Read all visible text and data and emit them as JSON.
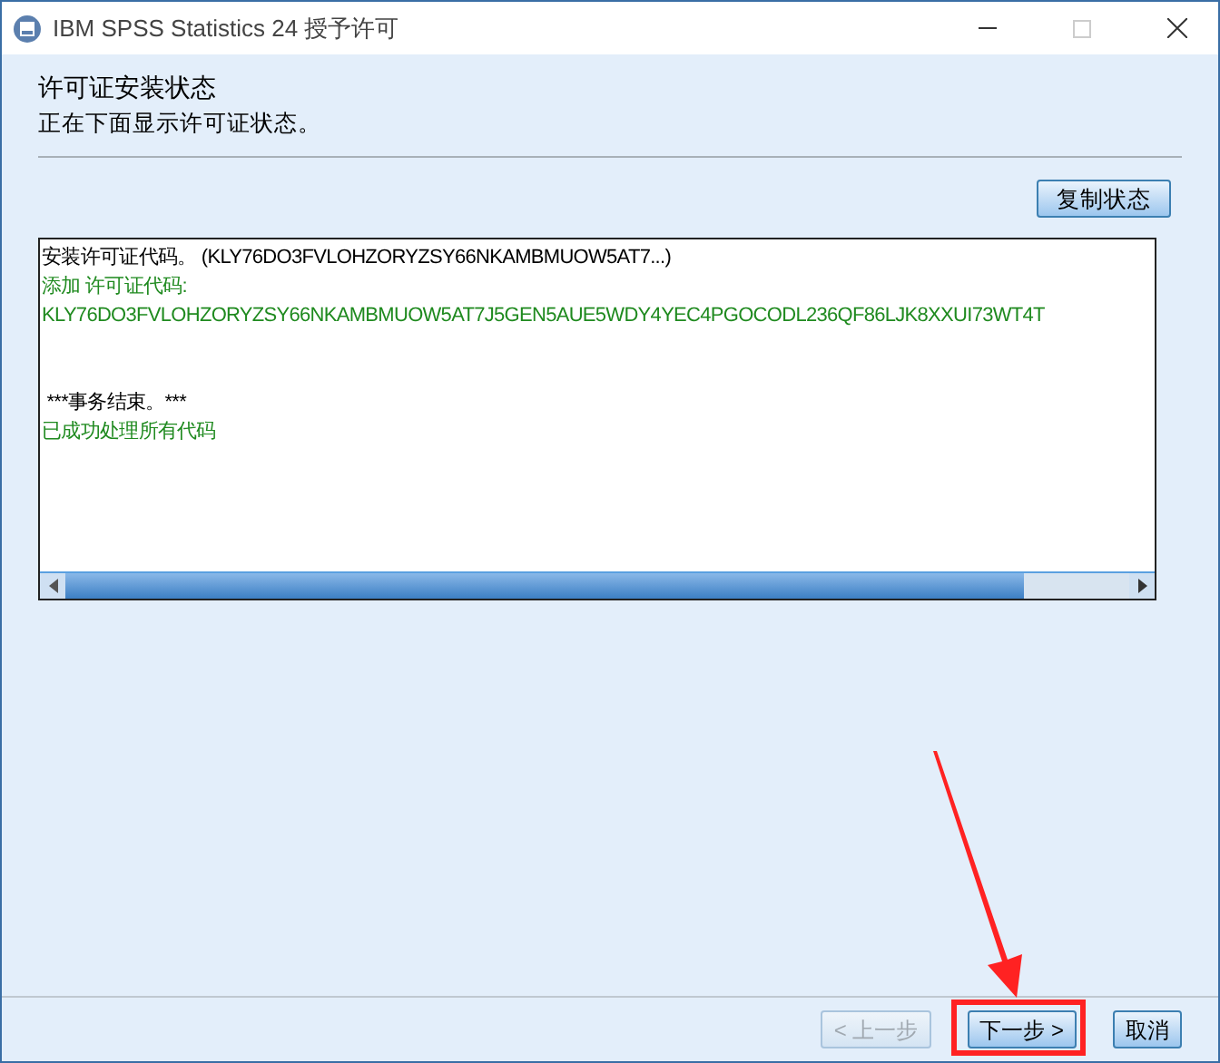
{
  "window": {
    "title": "IBM SPSS Statistics 24 授予许可"
  },
  "header": {
    "title": "许可证安装状态",
    "subtitle": "正在下面显示许可证状态。"
  },
  "copy_button": {
    "label": "复制状态"
  },
  "log": [
    {
      "kind": "plain",
      "text": "安装许可证代码。 (KLY76DO3FVLOHZORYZSY66NKAMBMUOW5AT7...)"
    },
    {
      "kind": "success",
      "text": "添加 许可证代码:"
    },
    {
      "kind": "success",
      "text": "KLY76DO3FVLOHZORYZSY66NKAMBMUOW5AT7J5GEN5AUE5WDY4YEC4PGOCODL236QF86LJK8XXUI73WT4T"
    },
    {
      "kind": "summary",
      "text": " ***事务结束。***"
    },
    {
      "kind": "success",
      "text": "已成功处理所有代码"
    }
  ],
  "buttons": [
    {
      "label": "< 上一步",
      "disabled": true,
      "highlighted": false
    },
    {
      "label": "下一步 >",
      "disabled": false,
      "highlighted": true
    },
    {
      "label": "取消",
      "disabled": false,
      "highlighted": false
    }
  ]
}
